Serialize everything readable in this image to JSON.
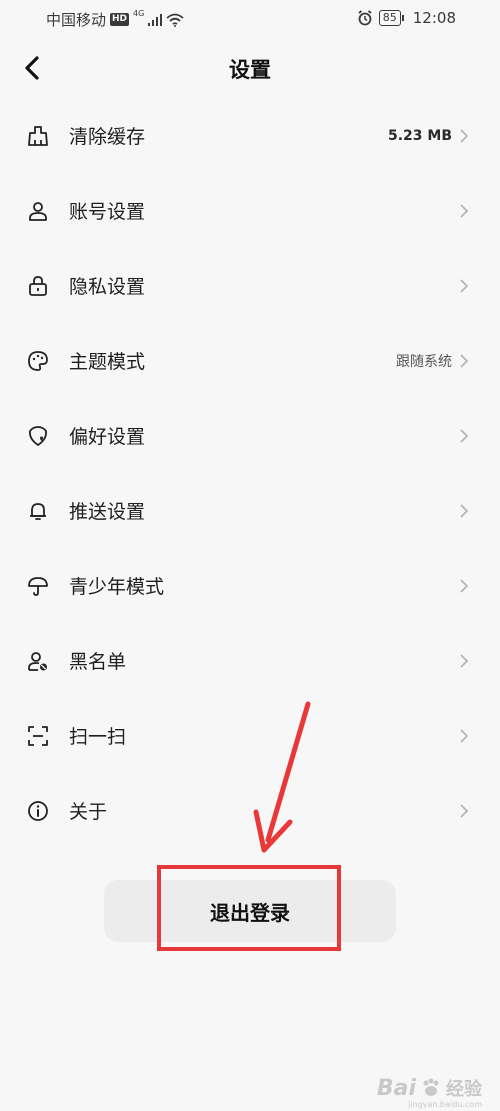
{
  "status_bar": {
    "carrier": "中国移动",
    "hd": "HD",
    "network": "4G",
    "battery": "85",
    "time": "12:08"
  },
  "header": {
    "title": "设置"
  },
  "menu": [
    {
      "label": "清除缓存",
      "value": "5.23 MB",
      "icon": "broom-icon"
    },
    {
      "label": "账号设置",
      "value": "",
      "icon": "user-icon"
    },
    {
      "label": "隐私设置",
      "value": "",
      "icon": "lock-icon"
    },
    {
      "label": "主题模式",
      "value": "跟随系统",
      "icon": "palette-icon"
    },
    {
      "label": "偏好设置",
      "value": "",
      "icon": "shield-heart-icon"
    },
    {
      "label": "推送设置",
      "value": "",
      "icon": "bell-icon"
    },
    {
      "label": "青少年模式",
      "value": "",
      "icon": "umbrella-icon"
    },
    {
      "label": "黑名单",
      "value": "",
      "icon": "user-block-icon"
    },
    {
      "label": "扫一扫",
      "value": "",
      "icon": "scan-icon"
    },
    {
      "label": "关于",
      "value": "",
      "icon": "info-icon"
    }
  ],
  "logout": {
    "label": "退出登录"
  },
  "annotation": {
    "color": "#e8383a"
  },
  "watermark": {
    "brand": "Bai",
    "brand_suffix": "经验",
    "domain": "jingyan.baidu.com"
  }
}
